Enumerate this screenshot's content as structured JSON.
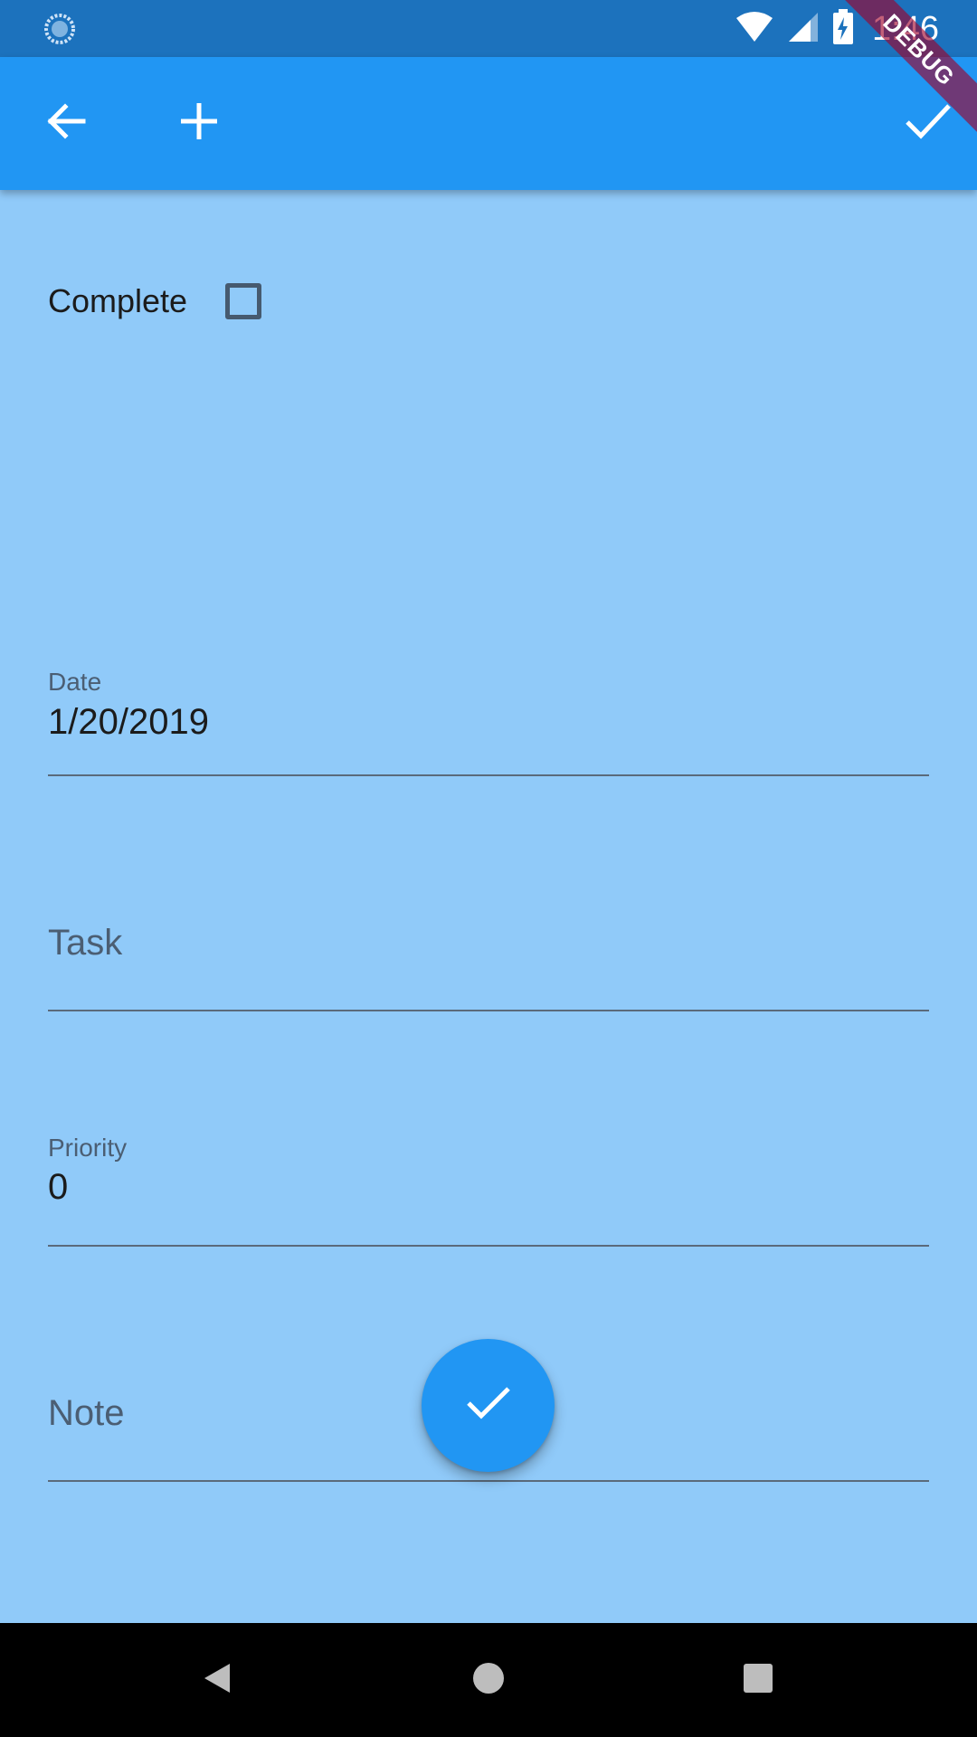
{
  "status_bar": {
    "time": "1:46",
    "icons": [
      "sync-icon",
      "wifi-icon",
      "signal-icon",
      "battery-charging-icon"
    ]
  },
  "app_bar": {
    "background": "#2196F3",
    "icons": [
      "back-arrow-icon",
      "add-icon",
      "checkmark-icon"
    ]
  },
  "debug_banner": {
    "text": "DEBUG"
  },
  "form": {
    "complete": {
      "label": "Complete",
      "checked": false
    },
    "date": {
      "label": "Date",
      "value": "1/20/2019"
    },
    "task": {
      "placeholder": "Task",
      "value": ""
    },
    "priority": {
      "label": "Priority",
      "value": "0"
    },
    "note": {
      "placeholder": "Note",
      "value": ""
    }
  },
  "fab": {
    "icon": "checkmark-icon",
    "color": "#2196F3"
  },
  "nav_bar": {
    "buttons": [
      "back-triangle-icon",
      "home-circle-icon",
      "recents-square-icon"
    ]
  },
  "colors": {
    "status_bar": "#1C72BD",
    "app_bar": "#2196F3",
    "background": "#90CAF9"
  }
}
